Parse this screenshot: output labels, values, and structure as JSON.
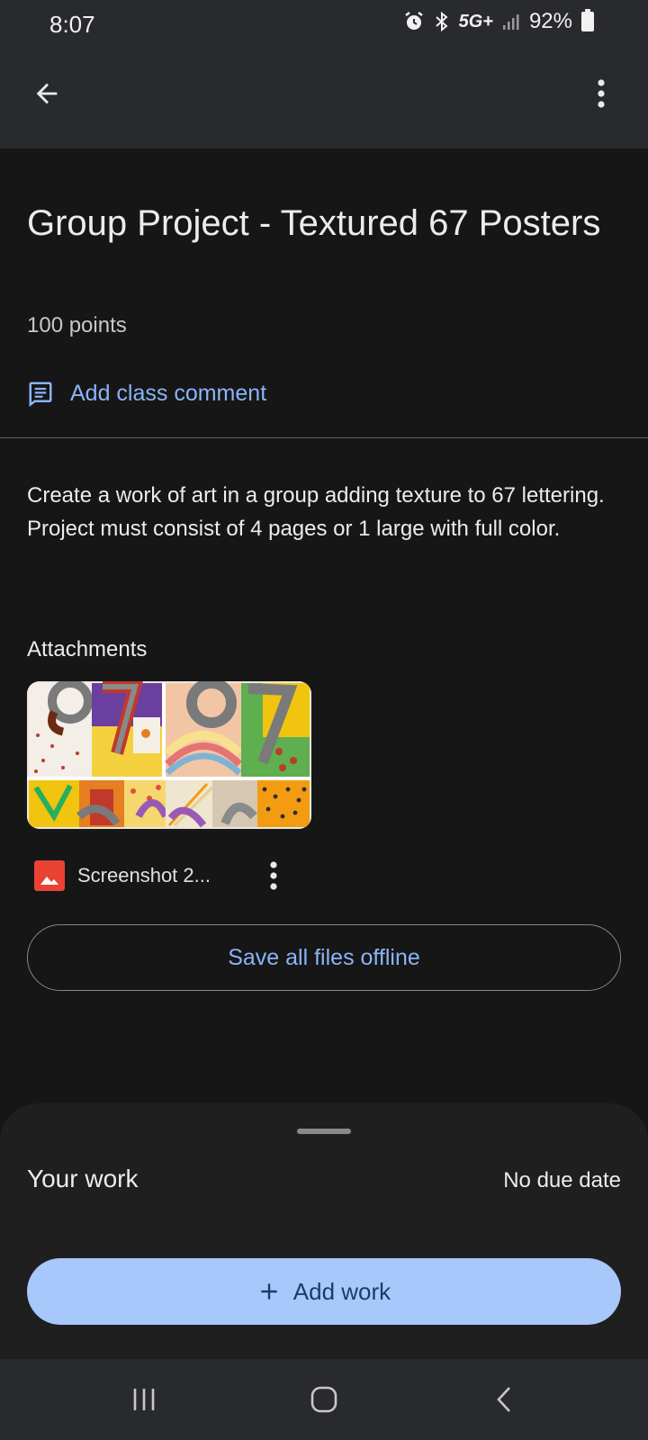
{
  "status_bar": {
    "time": "8:07",
    "network": "5G+",
    "battery": "92%"
  },
  "assignment": {
    "title": "Group Project - Textured 67 Posters",
    "points": "100 points",
    "add_comment_label": "Add class comment",
    "description": "Create a work of art in a group adding texture to 67 lettering. Project must consist of 4 pages or 1 large with full color."
  },
  "attachments": {
    "heading": "Attachments",
    "items": [
      {
        "name": "Screenshot 2...",
        "icon": "image-file-icon"
      }
    ],
    "save_offline_label": "Save all files offline"
  },
  "your_work": {
    "heading": "Your work",
    "due": "No due date",
    "add_work_label": "Add work"
  },
  "colors": {
    "background": "#161616",
    "app_bar": "#292a2d",
    "accent": "#8ab4f8",
    "primary_button": "#a8c7fa",
    "file_icon": "#e94235"
  }
}
